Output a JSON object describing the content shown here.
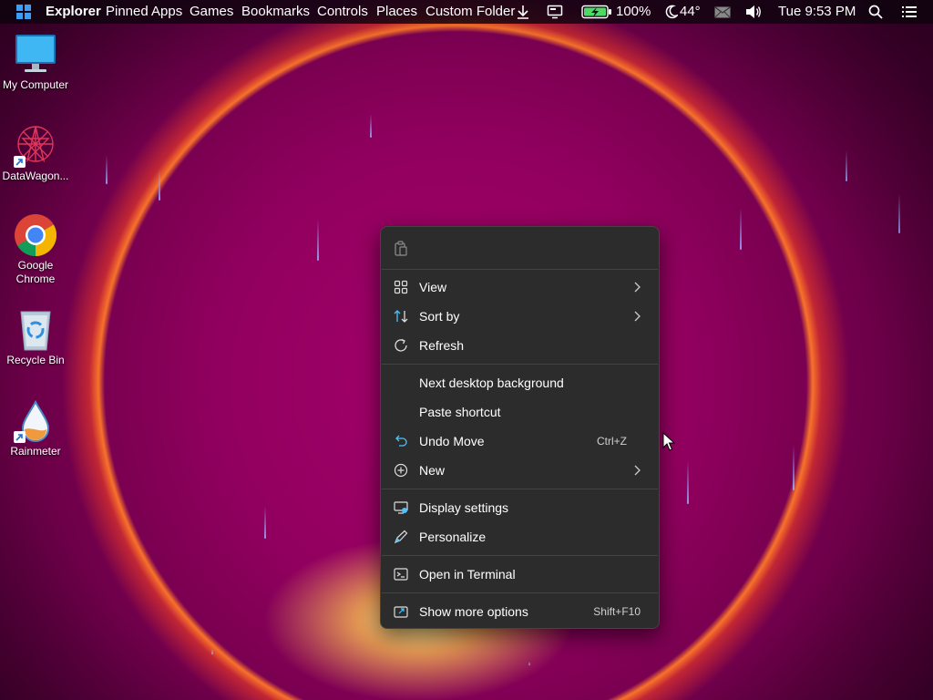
{
  "taskbar": {
    "menu": [
      "Explorer",
      "Pinned Apps",
      "Games",
      "Bookmarks",
      "Controls",
      "Places",
      "Custom Folder"
    ],
    "battery_text": "100%",
    "weather_text": "44°",
    "clock_text": "Tue 9:53 PM",
    "icons": [
      "windows-logo-icon",
      "download-icon",
      "monitor-icon",
      "battery-charging-icon",
      "moon-icon",
      "mail-icon",
      "volume-icon",
      "search-icon",
      "list-menu-icon"
    ]
  },
  "desktop_icons": [
    {
      "label": "My Computer",
      "icon": "monitor-icon"
    },
    {
      "label": "DataWagon...",
      "icon": "datawagon-icon"
    },
    {
      "label": "Google Chrome",
      "icon": "chrome-icon"
    },
    {
      "label": "Recycle Bin",
      "icon": "recycle-bin-icon"
    },
    {
      "label": "Rainmeter",
      "icon": "rainmeter-icon"
    }
  ],
  "context_menu": {
    "top_actions": [
      {
        "icon": "paste-icon"
      }
    ],
    "items": [
      {
        "label": "View",
        "icon": "grid-icon",
        "submenu": true
      },
      {
        "label": "Sort by",
        "icon": "sort-icon",
        "submenu": true
      },
      {
        "label": "Refresh",
        "icon": "refresh-icon"
      },
      {
        "label": "Next desktop background"
      },
      {
        "label": "Paste shortcut"
      },
      {
        "label": "Undo Move",
        "icon": "undo-icon",
        "shortcut": "Ctrl+Z"
      },
      {
        "label": "New",
        "icon": "plus-circle-icon",
        "submenu": true
      },
      {
        "label": "Display settings",
        "icon": "display-settings-icon"
      },
      {
        "label": "Personalize",
        "icon": "pen-icon"
      },
      {
        "label": "Open in Terminal",
        "icon": "terminal-icon"
      },
      {
        "label": "Show more options",
        "icon": "more-options-icon",
        "shortcut": "Shift+F10"
      }
    ]
  },
  "colors": {
    "menu_bg": "#2c2c2c",
    "accent_blue": "#3f9cf5",
    "wallpaper_magenta": "#a4006a",
    "wallpaper_glow": "#ffd24a"
  }
}
